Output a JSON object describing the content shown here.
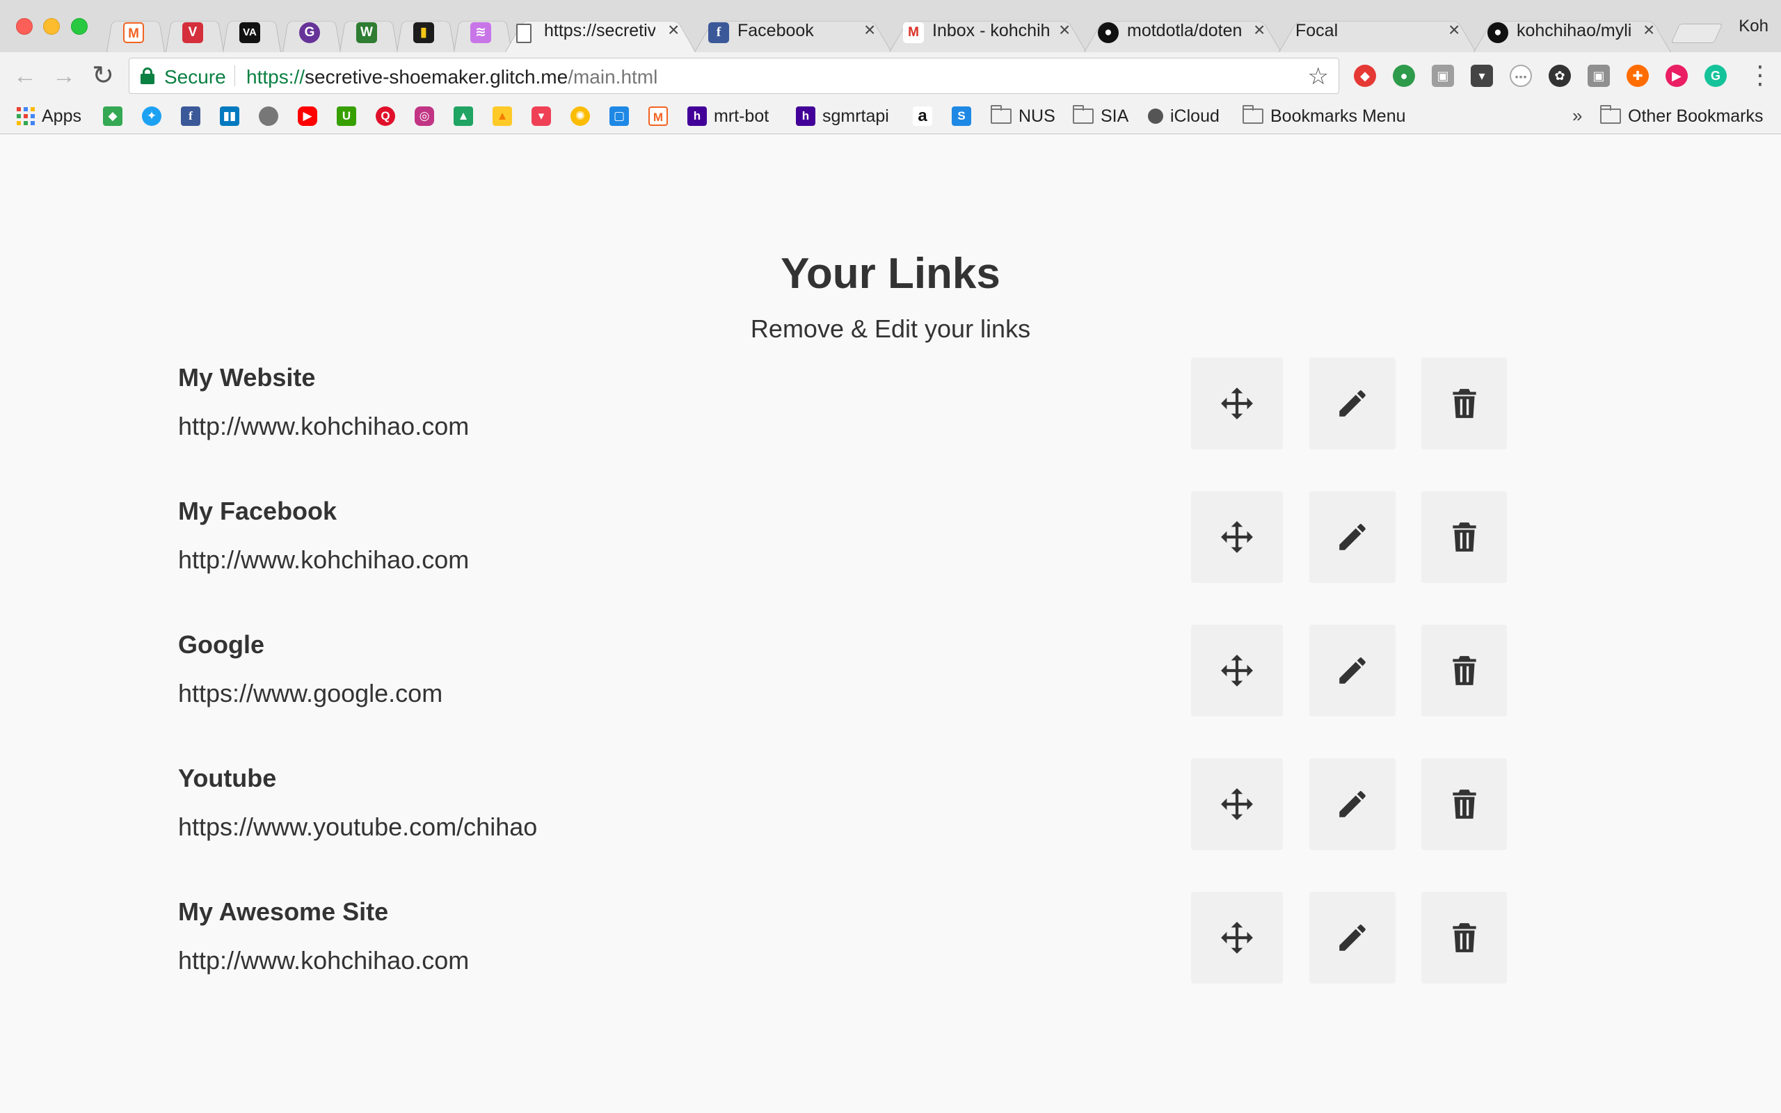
{
  "browser": {
    "tabs": [
      {
        "favicon": "magento-icon",
        "favicon_color": "#f26322",
        "favicon_text": "M",
        "title": ""
      },
      {
        "favicon": "vivaldi-icon",
        "favicon_color": "#d42f3b",
        "favicon_text": "V",
        "title": ""
      },
      {
        "favicon": "va-icon",
        "favicon_color": "#111111",
        "favicon_text": "VA",
        "title": ""
      },
      {
        "favicon": "circle-icon",
        "favicon_color": "#663399",
        "favicon_text": "G",
        "title": ""
      },
      {
        "favicon": "w-icon",
        "favicon_color": "#2e7d32",
        "favicon_text": "W",
        "title": ""
      },
      {
        "favicon": "lock-icon",
        "favicon_color": "#1c1c1c",
        "favicon_text": "▮",
        "title": ""
      },
      {
        "favicon": "glitch-icon",
        "favicon_color": "#c875e8",
        "favicon_text": "≋",
        "title": ""
      },
      {
        "favicon": "page-icon",
        "favicon_color": "#ffffff",
        "favicon_text": "",
        "title": "https://secretiv"
      },
      {
        "favicon": "facebook-icon",
        "favicon_color": "#3b5998",
        "favicon_text": "f",
        "title": "Facebook"
      },
      {
        "favicon": "gmail-icon",
        "favicon_color": "#ffffff",
        "favicon_text": "M",
        "title": "Inbox - kohchih"
      },
      {
        "favicon": "github-icon",
        "favicon_color": "#111111",
        "favicon_text": "●",
        "title": "motdotla/doten"
      },
      {
        "favicon": "",
        "favicon_color": "",
        "favicon_text": "",
        "title": "Focal"
      },
      {
        "favicon": "github-icon",
        "favicon_color": "#111111",
        "favicon_text": "●",
        "title": "kohchihao/myli"
      }
    ],
    "profile_name": "Koh",
    "omnibox": {
      "secure_label": "Secure",
      "url_scheme": "https://",
      "url_host": "secretive-shoemaker.glitch.me",
      "url_path": "/main.html"
    },
    "bookmarks": {
      "apps_label": "Apps",
      "named": [
        {
          "icon": "heroku-icon",
          "label": "mrt-bot"
        },
        {
          "icon": "heroku-icon",
          "label": "sgmrtapi"
        }
      ],
      "folders": [
        "NUS",
        "SIA"
      ],
      "icloud_label": "iCloud",
      "menu_label": "Bookmarks Menu",
      "more_label": "»",
      "other_label": "Other Bookmarks"
    }
  },
  "page": {
    "title": "Your Links",
    "subtitle": "Remove & Edit your links",
    "links": [
      {
        "name": "My Website",
        "url": "http://www.kohchihao.com"
      },
      {
        "name": "My Facebook",
        "url": "http://www.kohchihao.com"
      },
      {
        "name": "Google",
        "url": "https://www.google.com"
      },
      {
        "name": "Youtube",
        "url": "https://www.youtube.com/chihao"
      },
      {
        "name": "My Awesome Site",
        "url": "http://www.kohchihao.com"
      }
    ]
  }
}
